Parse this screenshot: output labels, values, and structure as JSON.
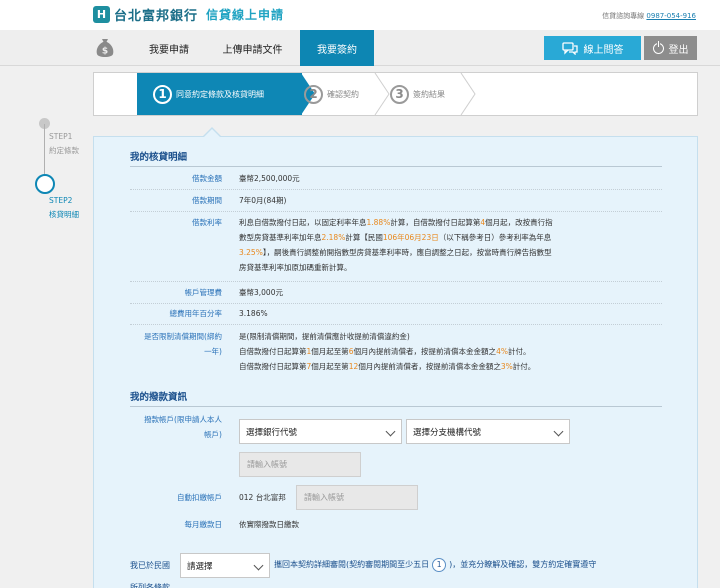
{
  "header": {
    "logo_mark": "H",
    "bank_name": "台北富邦銀行",
    "service_name": "信貸線上申請",
    "hotline_label": "信貸諮詢專線",
    "hotline_number": "0987-054-916"
  },
  "nav": {
    "tabs": [
      {
        "label": "我要申請",
        "active": false
      },
      {
        "label": "上傳申請文件",
        "active": false
      },
      {
        "label": "我要簽約",
        "active": true
      }
    ],
    "qa_button": "線上問答",
    "logout_button": "登出"
  },
  "steps": [
    {
      "num": "1",
      "label": "同意約定條款及核貸明細",
      "active": true
    },
    {
      "num": "2",
      "label": "確認契約",
      "active": false
    },
    {
      "num": "3",
      "label": "簽約結果",
      "active": false
    }
  ],
  "sidebar": {
    "step1_code": "STEP1",
    "step1_label": "約定條款",
    "step2_code": "STEP2",
    "step2_label": "核貸明細"
  },
  "loan_details": {
    "title": "我的核貸明細",
    "amount_label": "借款金額",
    "amount_value": "臺幣2,500,000元",
    "period_label": "借款期間",
    "period_value": "7年0月(84期)",
    "rate_label": "借款利率",
    "rate_text": {
      "p1": "利息自借款撥付日起，以固定利率年息",
      "r1": "1.88%",
      "p2": "計算，自借款撥付日起算第",
      "n1": "4",
      "p3": "個月起，改按貴行指",
      "p4": "數型房貸基準利率加年息",
      "r2": "2.18%",
      "p5": "計算【民國",
      "d1": "106年06月23日",
      "p6": "（以下稱參考日）參考利率為年息",
      "r3": "3.25%",
      "p7": "】，嗣後貴行調整前開指數型房貸基準利率時，應自調整之日起，按當時貴行牌告指數型",
      "p8": "房貸基準利率加原加碼重新計算。"
    },
    "fee_label": "帳戶管理費",
    "fee_value": "臺幣3,000元",
    "apr_label": "總費用年百分率",
    "apr_value": "3.186%",
    "prepay_label1": "是否限制清償期間(綁約",
    "prepay_label2": "一年)",
    "prepay_line1": "是(限制清償期間，提前清償應計收提前清償違約金)",
    "prepay_line2": {
      "a": "自借款撥付日起算第",
      "b": "1",
      "c": "個月起至第",
      "d": "6",
      "e": "個月內提前清償者，按提前清償本金金額之",
      "f": "4%",
      "g": "計付。"
    },
    "prepay_line3": {
      "a": "自借款撥付日起算第",
      "b": "7",
      "c": "個月起至第",
      "d": "12",
      "e": "個月內提前清償者，按提前清償本金金額之",
      "f": "3%",
      "g": "計付。"
    }
  },
  "repayment": {
    "title": "我的撥款資訊",
    "account_label1": "撥款帳戶(限申請人本人",
    "account_label2": "帳戶)",
    "bank_code_select": "選擇銀行代號",
    "branch_code_select": "選擇分支機構代號",
    "account_placeholder": "請輸入帳號",
    "autodebit_label": "自動扣繳帳戶",
    "autodebit_bank": "012 台北富邦",
    "autodebit_placeholder": "請輸入帳號",
    "payday_label": "每月繳款日",
    "payday_value": "依實際撥款日繳款"
  },
  "agreement": {
    "prefix": "我已於民國",
    "select": "請選擇",
    "text1": "攜回本契約詳細審閱(契約審閱期間至少五日",
    "badge": "1",
    "text2": ")，並充分瞭解及確認，雙方約定確實遵守",
    "text3": "所列各條款"
  }
}
